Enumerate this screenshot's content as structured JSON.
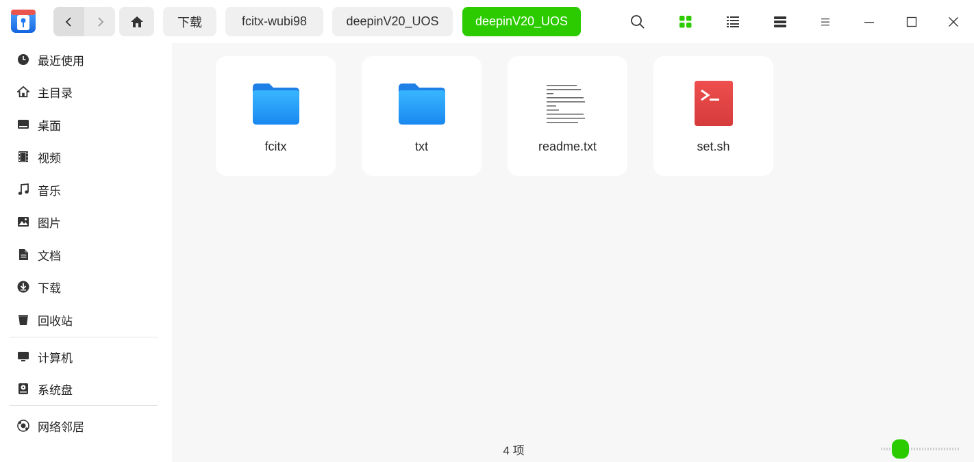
{
  "titlebar": {
    "breadcrumbs": [
      "下载",
      "fcitx-wubi98",
      "deepinV20_UOS",
      "deepinV20_UOS"
    ],
    "active_crumb_index": 3,
    "accent_color": "#2ccb00",
    "icons": {
      "app": "file-manager-logo-icon",
      "back": "chevron-left-icon",
      "forward": "chevron-right-icon",
      "home": "home-icon",
      "search": "search-icon",
      "grid_view": "grid-view-icon",
      "list_view": "list-view-icon",
      "detail_view": "detail-view-icon",
      "menu": "menu-icon",
      "minimize": "minimize-icon",
      "maximize": "maximize-icon",
      "close": "close-icon"
    },
    "selected_view": "grid"
  },
  "sidebar": {
    "items": [
      {
        "label": "最近使用",
        "icon": "clock-icon"
      },
      {
        "label": "主目录",
        "icon": "home-icon"
      },
      {
        "label": "桌面",
        "icon": "desktop-icon"
      },
      {
        "label": "视频",
        "icon": "film-icon"
      },
      {
        "label": "音乐",
        "icon": "music-note-icon"
      },
      {
        "label": "图片",
        "icon": "picture-icon"
      },
      {
        "label": "文档",
        "icon": "document-icon"
      },
      {
        "label": "下载",
        "icon": "download-icon"
      },
      {
        "label": "回收站",
        "icon": "trash-icon"
      },
      {
        "label": "计算机",
        "icon": "monitor-icon"
      },
      {
        "label": "系统盘",
        "icon": "disk-icon"
      },
      {
        "label": "网络邻居",
        "icon": "network-icon"
      }
    ]
  },
  "files": [
    {
      "name": "fcitx",
      "type": "folder",
      "icon": "folder-icon"
    },
    {
      "name": "txt",
      "type": "folder",
      "icon": "folder-icon"
    },
    {
      "name": "readme.txt",
      "type": "text",
      "icon": "text-preview"
    },
    {
      "name": "set.sh",
      "type": "script",
      "icon": "shell-script-icon"
    }
  ],
  "status_text": "4 项",
  "zoom_level_fraction": 0.22
}
